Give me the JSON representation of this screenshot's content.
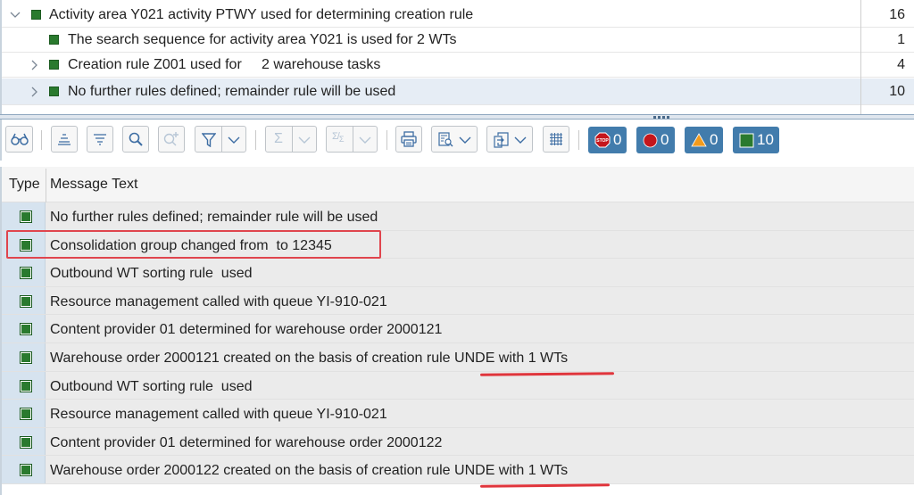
{
  "tree": {
    "rows": [
      {
        "text": "Activity area Y021 activity PTWY used for determining creation rule",
        "count": "16",
        "expander": "chevron-down",
        "level": 0,
        "status": "success"
      },
      {
        "text": "The search sequence for activity area Y021 is used for 2 WTs",
        "count": "1",
        "expander": "none",
        "level": 1,
        "status": "success"
      },
      {
        "text": "Creation rule Z001 used for     2 warehouse tasks",
        "count": "4",
        "expander": "chevron-right",
        "level": 1,
        "status": "success"
      },
      {
        "text": "No further rules defined; remainder rule will be used",
        "count": "10",
        "expander": "chevron-right",
        "level": 1,
        "status": "success",
        "selected": true
      }
    ]
  },
  "toolbar": {
    "buttons": [
      {
        "name": "details-button",
        "icon": "glasses-icon"
      },
      {
        "name": "sort-ascending-button",
        "icon": "sort-ascending-icon"
      },
      {
        "name": "sort-descending-button",
        "icon": "sort-descending-icon"
      },
      {
        "name": "find-button",
        "icon": "search-icon"
      },
      {
        "name": "find-next-button",
        "icon": "search-plus-icon",
        "disabled": true
      },
      {
        "name": "filter-button",
        "icon": "filter-icon",
        "dropdown": true
      },
      {
        "name": "total-button",
        "icon": "sigma-icon",
        "dropdown": true,
        "disabled": true
      },
      {
        "name": "subtotal-button",
        "icon": "subtotal-icon",
        "dropdown": true,
        "disabled": true
      },
      {
        "name": "print-button",
        "icon": "printer-icon"
      },
      {
        "name": "layout-button",
        "icon": "layout-icon",
        "dropdown": true
      },
      {
        "name": "export-button",
        "icon": "export-icon",
        "dropdown": true
      },
      {
        "name": "grid-view-button",
        "icon": "grid-icon"
      }
    ],
    "status_counts": {
      "stop": "0",
      "error": "0",
      "warning": "0",
      "success": "10"
    },
    "colors": {
      "badge_bg": "#427cac",
      "success": "#2a7a2e",
      "error": "#c4161c",
      "warning": "#f29b1d"
    }
  },
  "grid": {
    "columns": {
      "type": "Type",
      "message": "Message Text"
    },
    "rows": [
      {
        "type": "success",
        "text": "No further rules defined; remainder rule will be used"
      },
      {
        "type": "success",
        "text": "Consolidation group changed from  to 12345",
        "annotation": "highlight-box"
      },
      {
        "type": "success",
        "text": "Outbound WT sorting rule  used"
      },
      {
        "type": "success",
        "text": "Resource management called with queue YI-910-021"
      },
      {
        "type": "success",
        "text": "Content provider 01 determined for warehouse order 2000121"
      },
      {
        "type": "success",
        "text": "Warehouse order 2000121 created on the basis of creation rule UNDE with 1 WTs",
        "annotation": "underline"
      },
      {
        "type": "success",
        "text": "Outbound WT sorting rule  used"
      },
      {
        "type": "success",
        "text": "Resource management called with queue YI-910-021"
      },
      {
        "type": "success",
        "text": "Content provider 01 determined for warehouse order 2000122"
      },
      {
        "type": "success",
        "text": "Warehouse order 2000122 created on the basis of creation rule UNDE with 1 WTs",
        "annotation": "underline"
      }
    ],
    "annotation_color": "#e0353c"
  }
}
